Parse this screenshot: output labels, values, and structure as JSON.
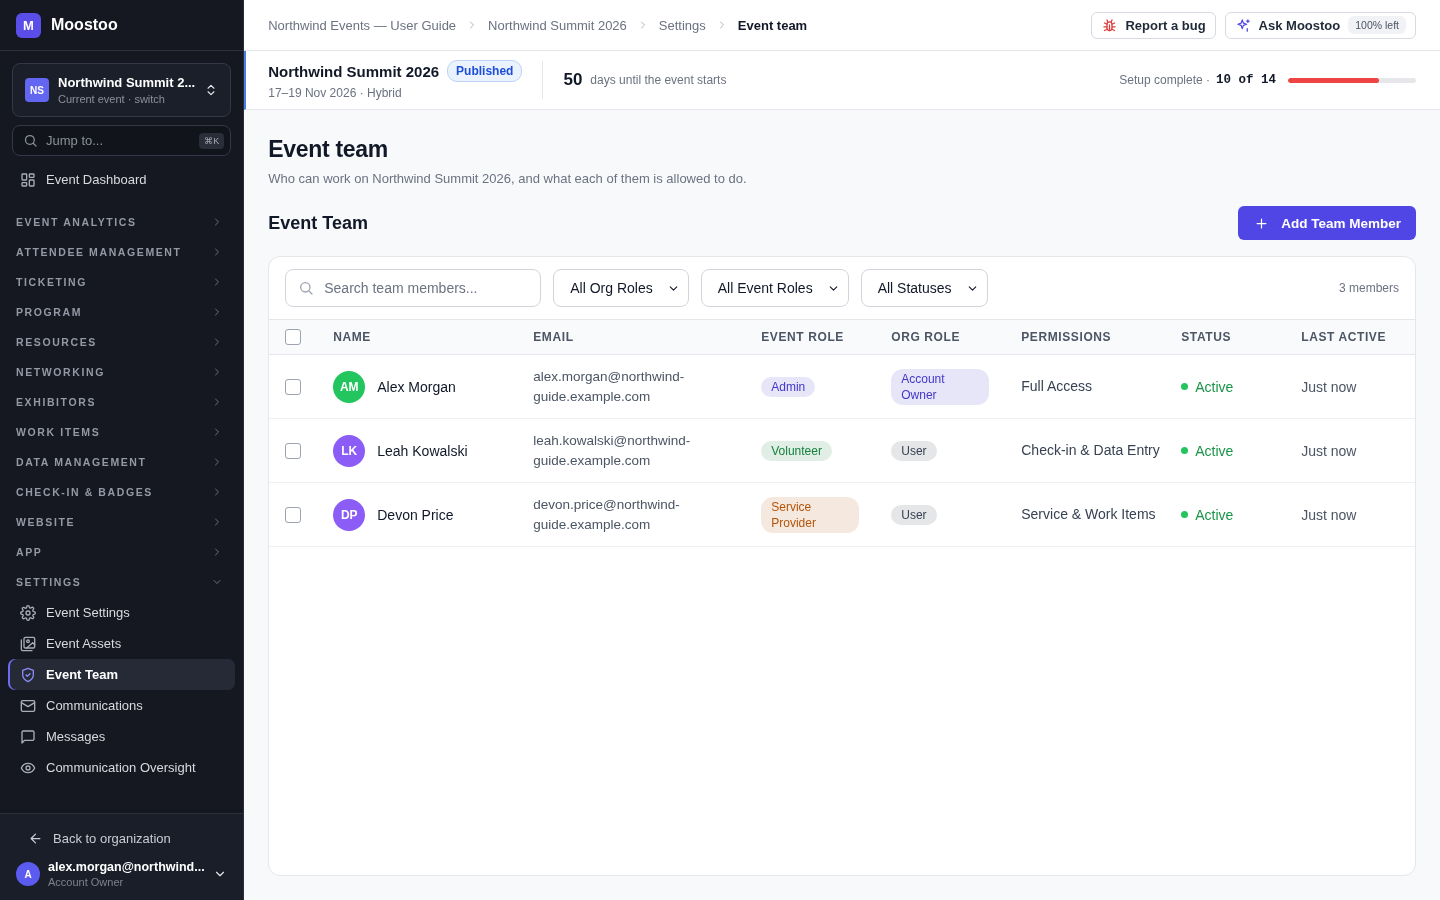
{
  "brand": {
    "logo": "M",
    "name": "Moostoo"
  },
  "event_switcher": {
    "initials": "NS",
    "name": "Northwind Summit 2...",
    "caption": "Current event · switch"
  },
  "jump": {
    "placeholder": "Jump to...",
    "shortcut": "⌘K"
  },
  "nav": [
    {
      "kind": "link",
      "label": "Event Dashboard",
      "selected": false
    },
    {
      "kind": "section",
      "label": "EVENT ANALYTICS",
      "expanded": false
    },
    {
      "kind": "section",
      "label": "ATTENDEE MANAGEMENT",
      "expanded": false
    },
    {
      "kind": "section",
      "label": "TICKETING",
      "expanded": false
    },
    {
      "kind": "section",
      "label": "PROGRAM",
      "expanded": false
    },
    {
      "kind": "section",
      "label": "RESOURCES",
      "expanded": false
    },
    {
      "kind": "section",
      "label": "NETWORKING",
      "expanded": false
    },
    {
      "kind": "section",
      "label": "EXHIBITORS",
      "expanded": false
    },
    {
      "kind": "section",
      "label": "WORK ITEMS",
      "expanded": false
    },
    {
      "kind": "section",
      "label": "DATA MANAGEMENT",
      "expanded": false
    },
    {
      "kind": "section",
      "label": "CHECK-IN & BADGES",
      "expanded": false
    },
    {
      "kind": "section",
      "label": "WEBSITE",
      "expanded": false
    },
    {
      "kind": "section",
      "label": "APP",
      "expanded": false
    },
    {
      "kind": "section",
      "label": "SETTINGS",
      "expanded": true,
      "children": [
        {
          "label": "Event Settings",
          "selected": false
        },
        {
          "label": "Event Assets",
          "selected": false
        },
        {
          "label": "Event Team",
          "selected": true
        },
        {
          "label": "Communications",
          "selected": false
        },
        {
          "label": "Messages",
          "selected": false
        },
        {
          "label": "Communication Oversight",
          "selected": false
        }
      ]
    }
  ],
  "sidebar_footer": {
    "back": "Back to organization",
    "user": {
      "initial": "A",
      "email": "alex.morgan@northwind...",
      "role": "Account Owner"
    }
  },
  "breadcrumbs": [
    {
      "label": "Northwind Events — User Guide",
      "current": false
    },
    {
      "label": "Northwind Summit 2026",
      "current": false
    },
    {
      "label": "Settings",
      "current": false
    },
    {
      "label": "Event team",
      "current": true
    }
  ],
  "top_actions": {
    "report": "Report a bug",
    "ask": "Ask Moostoo",
    "quota": "100% left"
  },
  "event_banner": {
    "title": "Northwind Summit 2026",
    "status": "Published",
    "meta": "17–19 Nov 2026 · Hybrid",
    "days": "50",
    "days_caption": "days until the event starts",
    "setup_label": "Setup complete ·",
    "setup_count": "10 of 14",
    "level": 0.71
  },
  "page": {
    "title": "Event team",
    "subtitle": "Who can work on Northwind Summit 2026, and what each of them is allowed to do."
  },
  "section": {
    "title": "Event Team",
    "add_button": "Add Team Member"
  },
  "filters": {
    "search_placeholder": "Search team members...",
    "selects": [
      "All Org Roles",
      "All Event Roles",
      "All Statuses"
    ],
    "count": "3 members"
  },
  "table": {
    "select_all": {
      "checked": false
    },
    "columns": [
      "NAME",
      "EMAIL",
      "EVENT ROLE",
      "ORG ROLE",
      "PERMISSIONS",
      "STATUS",
      "LAST ACTIVE"
    ],
    "rows": [
      {
        "checked": false,
        "initials": "AM",
        "color": "#22c55e",
        "name": "Alex Morgan",
        "email": "alex.morgan@northwind-guide.example.com",
        "event_role": {
          "label": "Admin",
          "color": "#4338ca"
        },
        "org_role": {
          "label": "Account Owner",
          "color": "#4338ca"
        },
        "permissions": "Full Access",
        "status": {
          "label": "Active",
          "color": "#22c55e"
        },
        "last_active": "Just now"
      },
      {
        "checked": false,
        "initials": "LK",
        "color": "#8b5cf6",
        "name": "Leah Kowalski",
        "email": "leah.kowalski@northwind-guide.example.com",
        "event_role": {
          "label": "Volunteer",
          "color": "#15803d"
        },
        "org_role": {
          "label": "User",
          "color": "#374151"
        },
        "permissions": "Check-in & Data Entry",
        "status": {
          "label": "Active",
          "color": "#22c55e"
        },
        "last_active": "Just now"
      },
      {
        "checked": false,
        "initials": "DP",
        "color": "#8b5cf6",
        "name": "Devon Price",
        "email": "devon.price@northwind-guide.example.com",
        "event_role": {
          "label": "Service Provider",
          "color": "#b45309"
        },
        "org_role": {
          "label": "User",
          "color": "#374151"
        },
        "permissions": "Service & Work Items",
        "status": {
          "label": "Active",
          "color": "#22c55e"
        },
        "last_active": "Just now"
      }
    ]
  }
}
